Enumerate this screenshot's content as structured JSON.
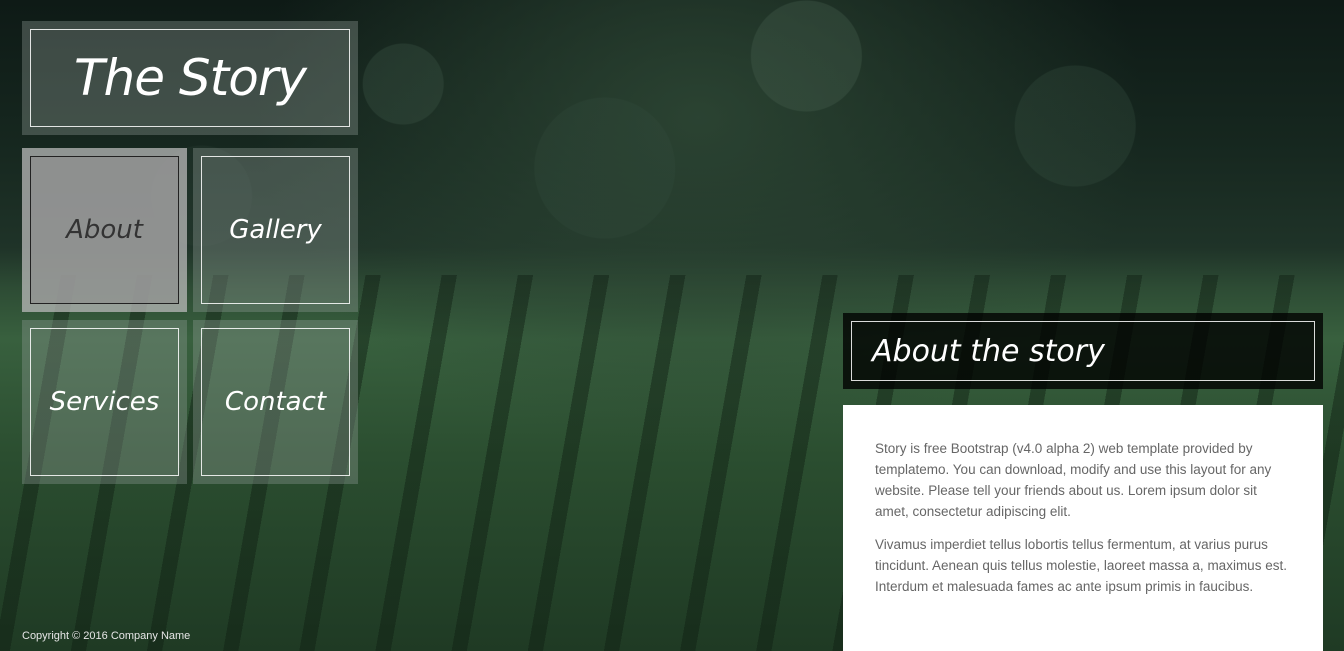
{
  "site": {
    "title": "The Story"
  },
  "nav": {
    "items": [
      {
        "label": "About",
        "active": true
      },
      {
        "label": "Gallery",
        "active": false
      },
      {
        "label": "Services",
        "active": false
      },
      {
        "label": "Contact",
        "active": false
      }
    ]
  },
  "section": {
    "title": "About the story",
    "paragraphs": [
      "Story is free Bootstrap (v4.0 alpha 2) web template provided by templatemo. You can download, modify and use this layout for any website. Please tell your friends about us. Lorem ipsum dolor sit amet, consectetur adipiscing elit.",
      "Vivamus imperdiet tellus lobortis tellus fermentum, at varius purus tincidunt. Aenean quis tellus molestie, laoreet massa a, maximus est. Interdum et malesuada fames ac ante ipsum primis in faucibus."
    ]
  },
  "footer": {
    "copyright": "Copyright © 2016 Company Name"
  },
  "colors": {
    "panel_bg": "#ffffff",
    "text_body": "#666666",
    "title_text": "#ffffff"
  }
}
